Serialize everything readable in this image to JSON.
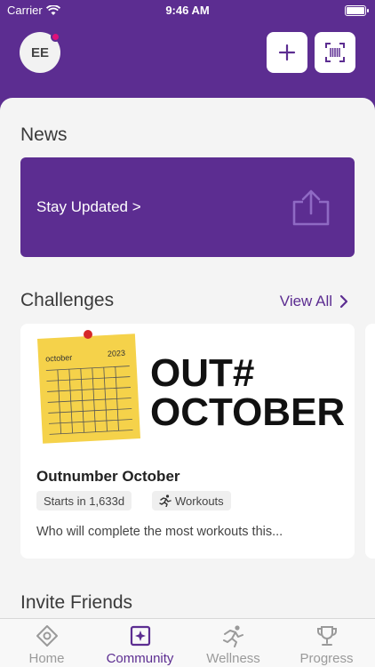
{
  "status": {
    "carrier": "Carrier",
    "time": "9:46 AM"
  },
  "header": {
    "avatar_initials": "EE"
  },
  "news": {
    "title": "News",
    "banner_label": "Stay Updated >"
  },
  "challenges": {
    "title": "Challenges",
    "view_all": "View All",
    "card": {
      "image_note_month": "october",
      "image_note_year": "2023",
      "image_heading_line1": "OUT#",
      "image_heading_line2": "OCTOBER",
      "name": "Outnumber October",
      "starts": "Starts in 1,633d",
      "type": "Workouts",
      "description": "Who will complete the most workouts this..."
    }
  },
  "invite": {
    "title": "Invite Friends"
  },
  "tabs": [
    {
      "label": "Home",
      "icon": "home-icon",
      "active": false
    },
    {
      "label": "Community",
      "icon": "community-icon",
      "active": true
    },
    {
      "label": "Wellness",
      "icon": "wellness-icon",
      "active": false
    },
    {
      "label": "Progress",
      "icon": "trophy-icon",
      "active": false
    }
  ],
  "colors": {
    "brand": "#5c2d91",
    "accent_dot": "#e0107a"
  }
}
